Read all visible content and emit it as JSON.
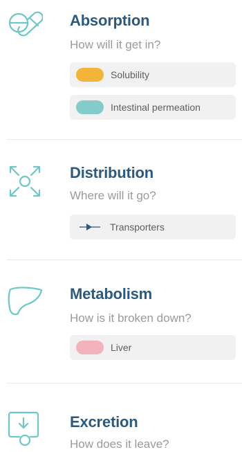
{
  "colors": {
    "title": "#2b5a7e",
    "subtitle": "#9a9a9a",
    "icon": "#6ec7c7",
    "chip_bg": "#f1f1f1",
    "divider": "#e6e6e6"
  },
  "sections": [
    {
      "title": "Absorption",
      "subtitle": "How will it get in?",
      "icon": "pill-icon",
      "chips": [
        {
          "label": "Solubility",
          "swatch_color": "#f2b53a"
        },
        {
          "label": "Intestinal permeation",
          "swatch_color": "#84cccc"
        }
      ]
    },
    {
      "title": "Distribution",
      "subtitle": "Where will it go?",
      "icon": "distribution-arrows-icon",
      "chips": [
        {
          "label": "Transporters",
          "glyph": "transporter-icon"
        }
      ]
    },
    {
      "title": "Metabolism",
      "subtitle": "How is it broken down?",
      "icon": "liver-icon",
      "chips": [
        {
          "label": "Liver",
          "swatch_color": "#f2b3bb"
        }
      ]
    },
    {
      "title": "Excretion",
      "subtitle": "How does it leave?",
      "icon": "excretion-icon",
      "chips": []
    }
  ]
}
